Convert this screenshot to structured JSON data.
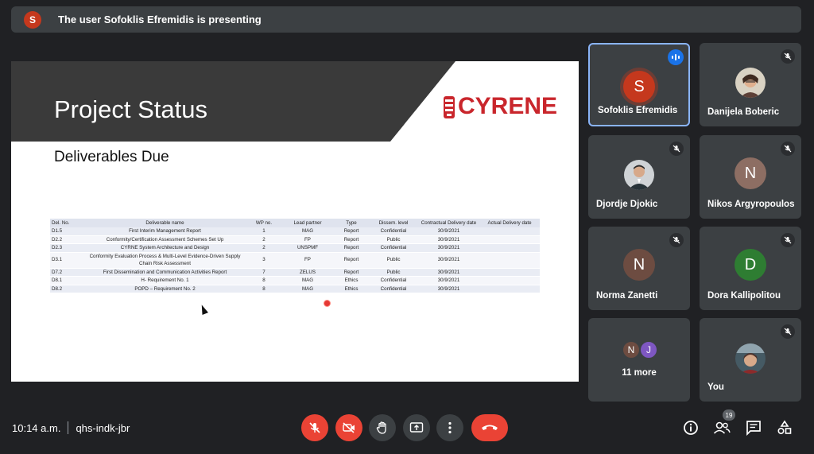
{
  "banner": {
    "avatar_initial": "S",
    "text": "The user Sofoklis Efremidis is presenting"
  },
  "slide": {
    "title": "Project Status",
    "logo_text": "CYRENE",
    "subtitle": "Deliverables Due",
    "table": {
      "headers": [
        "Del. No.",
        "Deliverable name",
        "WP no.",
        "Lead partner",
        "Type",
        "Dissem. level",
        "Contractual Delivery date",
        "Actual Delivery date"
      ],
      "rows": [
        [
          "D1.5",
          "First Interim Management Report",
          "1",
          "MAG",
          "Report",
          "Confidential",
          "30/9/2021",
          ""
        ],
        [
          "D2.2",
          "Conformity/Certification Assessment Schemes Set Up",
          "2",
          "FP",
          "Report",
          "Public",
          "30/9/2021",
          ""
        ],
        [
          "D2.3",
          "CYRNE System Architecture and Design",
          "2",
          "UNSPMF",
          "Report",
          "Confidential",
          "30/9/2021",
          ""
        ],
        [
          "D3.1",
          "Conformity Evaluation Process & Multi-Level Evidence-Driven Supply Chain Risk Assessment",
          "3",
          "FP",
          "Report",
          "Public",
          "30/9/2021",
          ""
        ],
        [
          "D7.2",
          "First Dissemination and Communication Activities Report",
          "7",
          "ZELUS",
          "Report",
          "Public",
          "30/9/2021",
          ""
        ],
        [
          "D8.1",
          "H- Requirement No. 1",
          "8",
          "MAG",
          "Ethics",
          "Confidential",
          "30/9/2021",
          ""
        ],
        [
          "D8.2",
          "POPD – Requirement No. 2",
          "8",
          "MAG",
          "Ethics",
          "Confidential",
          "30/9/2021",
          ""
        ]
      ]
    }
  },
  "participants": [
    {
      "name": "Sofoklis Efremidis",
      "initial": "S",
      "color": "#c5381d",
      "speaking": true
    },
    {
      "name": "Danijela Boberic",
      "initial": "",
      "photo": true,
      "muted": true
    },
    {
      "name": "Djordje Djokic",
      "initial": "",
      "photo": true,
      "muted": true
    },
    {
      "name": "Nikos Argyropoulos",
      "initial": "N",
      "color": "#8d6e63",
      "muted": true
    },
    {
      "name": "Norma Zanetti",
      "initial": "N",
      "color": "#6d4c41",
      "muted": true
    },
    {
      "name": "Dora Kallipolitou",
      "initial": "D",
      "color": "#2e7d32",
      "muted": true
    },
    {
      "name": "11 more",
      "initials": [
        "N",
        "J"
      ],
      "colors": [
        "#6d4c41",
        "#7e57c2"
      ]
    },
    {
      "name": "You",
      "photo": true,
      "muted": true
    }
  ],
  "footer": {
    "time": "10:14 a.m.",
    "meeting_code": "qhs-indk-jbr",
    "people_count": "19"
  },
  "colors": {
    "background": "#202124",
    "tile": "#3c4043",
    "danger": "#ea4335",
    "active_border": "#8ab4f8",
    "speaking": "#1a73e8",
    "logo_red": "#c9262c"
  }
}
